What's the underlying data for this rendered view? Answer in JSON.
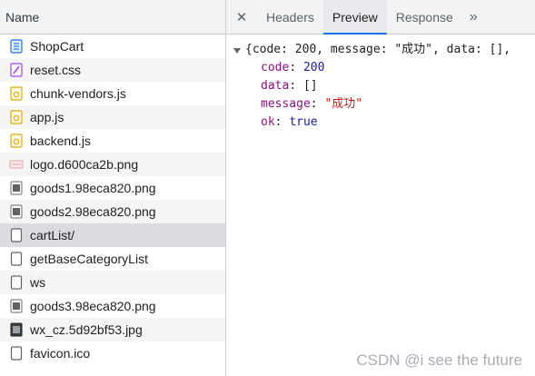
{
  "left": {
    "header": "Name",
    "files": [
      {
        "name": "ShopCart",
        "icon": "document-icon"
      },
      {
        "name": "reset.css",
        "icon": "stylesheet-icon"
      },
      {
        "name": "chunk-vendors.js",
        "icon": "script-icon"
      },
      {
        "name": "app.js",
        "icon": "script-icon"
      },
      {
        "name": "backend.js",
        "icon": "script-icon"
      },
      {
        "name": "logo.d600ca2b.png",
        "icon": "image-icon"
      },
      {
        "name": "goods1.98eca820.png",
        "icon": "image-icon"
      },
      {
        "name": "goods2.98eca820.png",
        "icon": "image-icon"
      },
      {
        "name": "cartList/",
        "icon": "blank-file-icon"
      },
      {
        "name": "getBaseCategoryList",
        "icon": "blank-file-icon"
      },
      {
        "name": "ws",
        "icon": "blank-file-icon"
      },
      {
        "name": "goods3.98eca820.png",
        "icon": "image-icon"
      },
      {
        "name": "wx_cz.5d92bf53.jpg",
        "icon": "image-icon"
      },
      {
        "name": "favicon.ico",
        "icon": "blank-file-icon"
      }
    ]
  },
  "right": {
    "close": "✕",
    "tabs": [
      {
        "label": "Headers"
      },
      {
        "label": "Preview"
      },
      {
        "label": "Response"
      }
    ],
    "more": "»",
    "preview": {
      "summary": "{code: 200, message: \"成功\", data: [],",
      "lines": [
        {
          "key": "code",
          "value": "200"
        },
        {
          "key": "data",
          "value": "[]"
        },
        {
          "key": "message",
          "value": "\"成功\""
        },
        {
          "key": "ok",
          "value": "true"
        }
      ]
    }
  },
  "watermark": "CSDN @i see the future",
  "colors": {
    "accent": "#1a73e8",
    "json_key": "#881280",
    "json_number": "#1a1aa6",
    "json_string": "#c41a16",
    "selected_row": "#dadce0"
  }
}
